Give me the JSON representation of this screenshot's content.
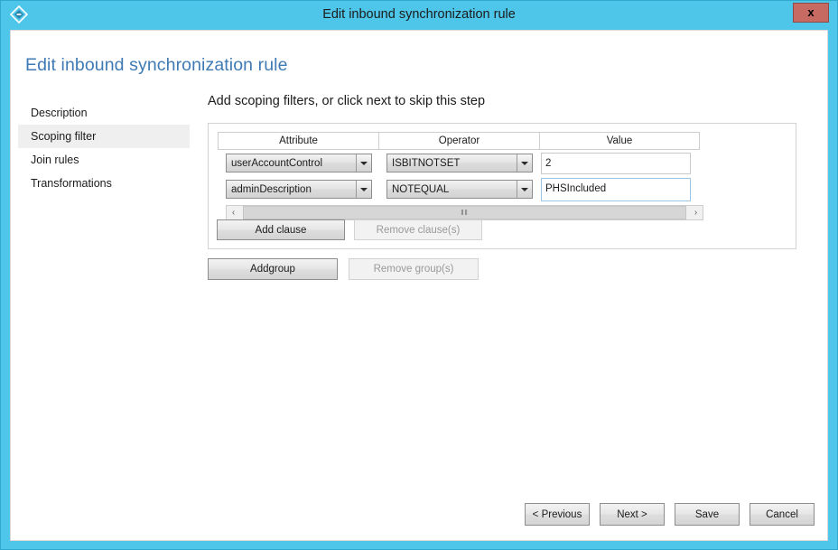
{
  "window": {
    "title": "Edit inbound synchronization rule",
    "icon": "diamond-sync-icon",
    "close_label": "x",
    "titlebar_color": "#4ec6ea",
    "close_color": "#c76a61"
  },
  "page": {
    "heading": "Edit inbound synchronization rule",
    "heading_color": "#3f7ab5"
  },
  "sidebar": {
    "items": [
      {
        "label": "Description",
        "selected": false
      },
      {
        "label": "Scoping filter",
        "selected": true
      },
      {
        "label": "Join rules",
        "selected": false
      },
      {
        "label": "Transformations",
        "selected": false
      }
    ]
  },
  "main": {
    "step_heading": "Add scoping filters, or click next to skip this step",
    "grid": {
      "columns": [
        "Attribute",
        "Operator",
        "Value"
      ],
      "rows": [
        {
          "attribute": "userAccountControl",
          "operator": "ISBITNOTSET",
          "value": "2",
          "value_focused": false
        },
        {
          "attribute": "adminDescription",
          "operator": "NOTEQUAL",
          "value": "PHSIncluded",
          "value_focused": true
        }
      ],
      "scrollbar": {
        "left_arrow": "‹",
        "right_arrow": "›",
        "grip": "‖‖"
      }
    },
    "clause_buttons": {
      "add": "Add clause",
      "remove": "Remove clause(s)",
      "remove_disabled": true
    },
    "group_buttons": {
      "add_prefix": "Add ",
      "add_accel": "g",
      "add_suffix": "roup",
      "add_full": "Add group",
      "remove": "Remove group(s)",
      "remove_disabled": true
    }
  },
  "footer": {
    "buttons": [
      {
        "label": "< Previous"
      },
      {
        "label": "Next >"
      },
      {
        "label": "Save"
      },
      {
        "label": "Cancel"
      }
    ]
  }
}
